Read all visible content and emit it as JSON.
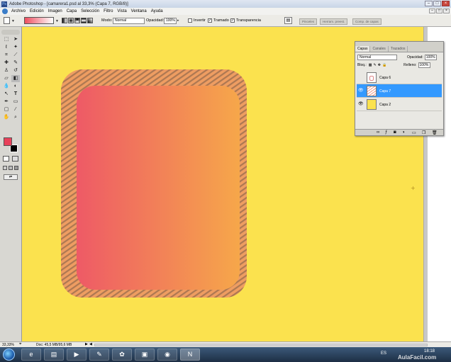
{
  "window": {
    "title": "Adobe Photoshop - [camarera1.psd al 33,3% (Capa 7, RGB/8)]"
  },
  "menu": [
    "Archivo",
    "Edición",
    "Imagen",
    "Capa",
    "Selección",
    "Filtro",
    "Vista",
    "Ventana",
    "Ayuda"
  ],
  "options": {
    "mode_label": "Modo:",
    "mode_value": "Normal",
    "opacity_label": "Opacidad:",
    "opacity_value": "100%",
    "invert_label": "Invertir",
    "dither_label": "Tramado",
    "transparency_label": "Transparencia",
    "well_tabs": [
      "Pinceles",
      "Herram. preest.",
      "Comp. de capas"
    ]
  },
  "colors": {
    "foreground": "#e8415a",
    "background": "#000000",
    "canvas": "#fbe24e",
    "gradient_start": "#ee5a66",
    "gradient_end": "#f6a74a",
    "selection": "#3399ff"
  },
  "layers_panel": {
    "tabs": [
      "Capas",
      "Canales",
      "Trazados"
    ],
    "blend_mode": "Normal",
    "opacity_label": "Opacidad:",
    "opacity_value": "100%",
    "lock_label": "Bloq.:",
    "fill_label": "Relleno:",
    "fill_value": "100%",
    "layers": [
      {
        "name": "Capa 6",
        "visible": false,
        "selected": false
      },
      {
        "name": "Capa 7",
        "visible": true,
        "selected": true
      },
      {
        "name": "Capa 2",
        "visible": true,
        "selected": false
      }
    ]
  },
  "status": {
    "zoom": "33,33%",
    "doc": "Doc: 45,5 MB/95,6 MB"
  },
  "taskbar": {
    "lang": "ES",
    "time": "18:18",
    "watermark": "AulaFacil.com"
  }
}
